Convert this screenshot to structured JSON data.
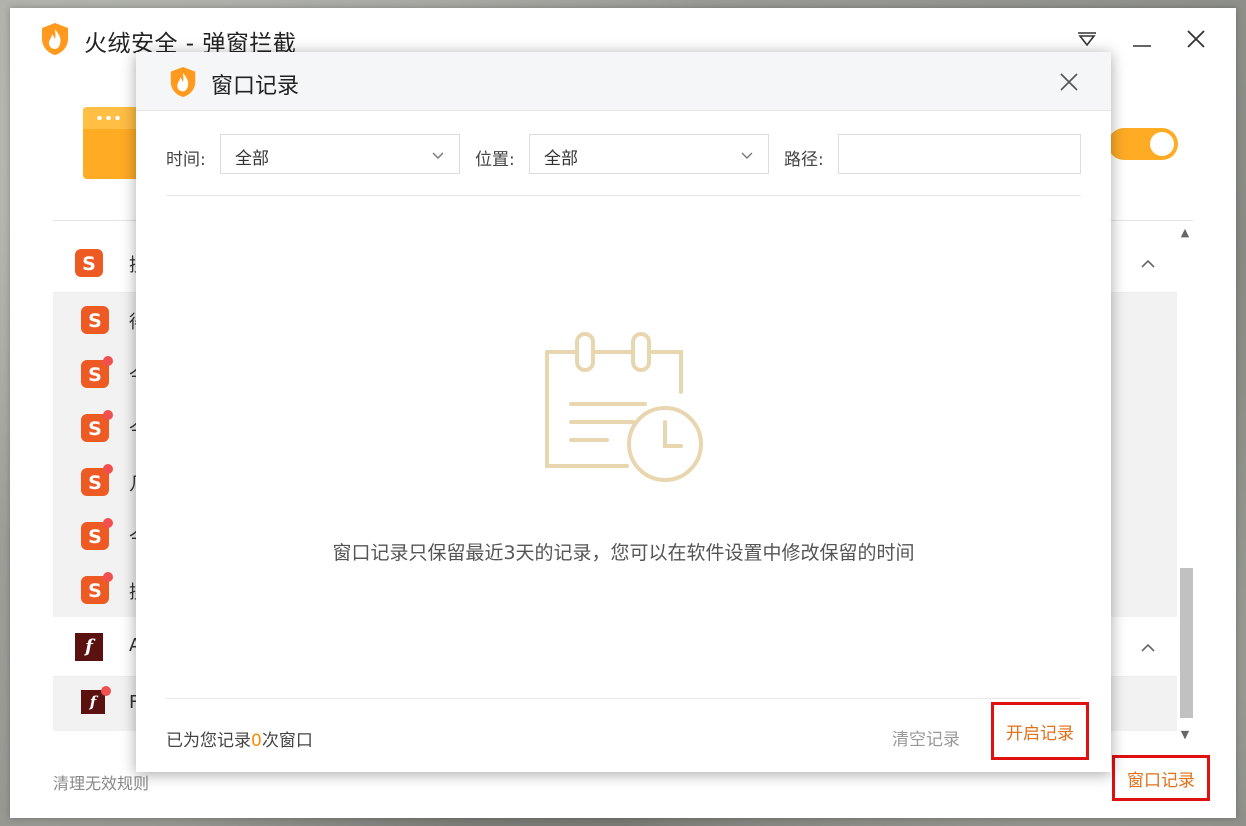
{
  "app": {
    "title": "火绒安全 - 弹窗拦截",
    "accent_color": "#ffab24",
    "icons": [
      "huorong-shield-icon",
      "menu-triangle-icon",
      "minimize-icon",
      "close-icon"
    ]
  },
  "main": {
    "list_groups": [
      {
        "icon": "sogou-icon",
        "label": "搜",
        "sub_items": [
          {
            "icon": "sogou-icon",
            "label": "得",
            "badge": false
          },
          {
            "icon": "sogou-icon",
            "label": "今",
            "badge": true
          },
          {
            "icon": "sogou-icon",
            "label": "今",
            "badge": true
          },
          {
            "icon": "sogou-icon",
            "label": "几",
            "badge": true
          },
          {
            "icon": "sogou-icon",
            "label": "今",
            "badge": true
          },
          {
            "icon": "sogou-icon",
            "label": "搜",
            "badge": true
          }
        ]
      },
      {
        "icon": "flash-icon",
        "label": "A",
        "sub_items": [
          {
            "icon": "flash-icon",
            "label": "F",
            "badge": true
          }
        ]
      }
    ],
    "cleanup_link": "清理无效规则",
    "window_record_link": "窗口记录"
  },
  "dialog": {
    "title": "窗口记录",
    "filters": {
      "time_label": "时间:",
      "time_value": "全部",
      "location_label": "位置:",
      "location_value": "全部",
      "path_label": "路径:",
      "path_value": ""
    },
    "empty_message": "窗口记录只保留最近3天的记录，您可以在软件设置中修改保留的时间",
    "footer": {
      "count_prefix": "已为您记录",
      "count": "0",
      "count_suffix": "次窗口",
      "clear_label": "清空记录",
      "start_label": "开启记录"
    },
    "illustration_color": "#e8d6b0",
    "highlight_color": "#e01010"
  }
}
